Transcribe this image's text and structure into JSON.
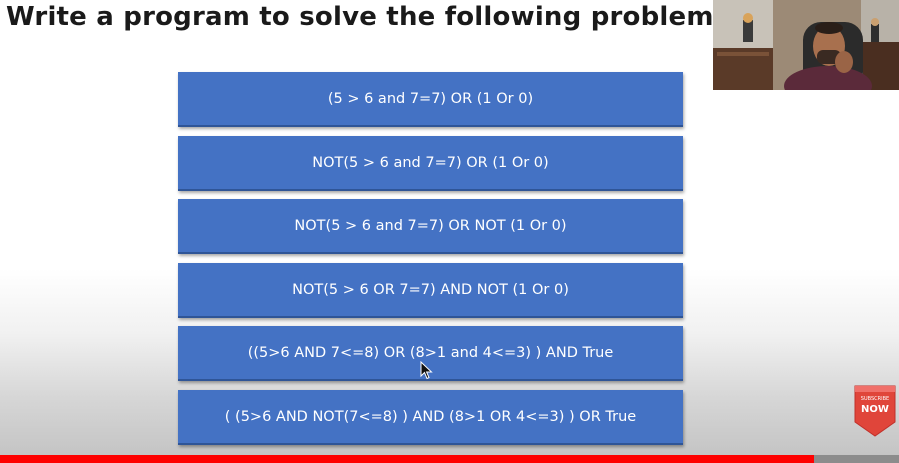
{
  "slide": {
    "title": "Write a program to solve the following problems:"
  },
  "problems": [
    "(5 > 6 and 7=7) OR (1 Or 0)",
    "NOT(5 > 6 and 7=7) OR (1 Or 0)",
    "NOT(5 > 6 and 7=7) OR NOT (1 Or 0)",
    "NOT(5 > 6 OR 7=7) AND NOT (1 Or 0)",
    "((5>6 AND 7<=8) OR (8>1 and 4<=3) ) AND True",
    "( (5>6 AND NOT(7<=8) ) AND (8>1 OR 4<=3) ) OR True"
  ],
  "subscribe_badge": {
    "small_label": "SUBSCRIBE",
    "label": "NOW"
  },
  "video": {
    "progress": 0.906
  },
  "colors": {
    "box_fill": "#4472c4",
    "box_border": "#2f5597",
    "badge_red": "#e0453a",
    "progress_red": "#ff0000"
  },
  "icons": {
    "cursor": "mouse-pointer-icon",
    "webcam": "presenter-webcam",
    "badge": "subscribe-badge-icon"
  }
}
